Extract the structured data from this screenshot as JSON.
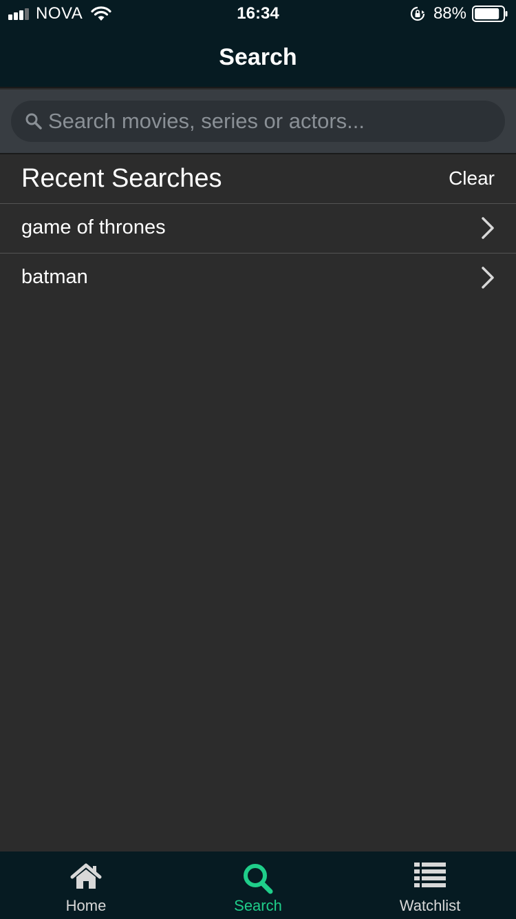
{
  "status_bar": {
    "carrier": "NOVA",
    "time": "16:34",
    "battery_percent": "88%",
    "battery_level": 0.88,
    "icons": [
      "signal-icon",
      "wifi-icon",
      "rotation-lock-icon",
      "battery-icon"
    ]
  },
  "nav": {
    "title": "Search"
  },
  "search": {
    "placeholder": "Search movies, series or actors...",
    "value": ""
  },
  "recent": {
    "title": "Recent Searches",
    "clear_label": "Clear",
    "items": [
      {
        "label": "game of thrones"
      },
      {
        "label": "batman"
      }
    ]
  },
  "tabs": [
    {
      "label": "Home",
      "icon": "home-icon",
      "active": false
    },
    {
      "label": "Search",
      "icon": "search-icon",
      "active": true
    },
    {
      "label": "Watchlist",
      "icon": "list-icon",
      "active": false
    }
  ],
  "colors": {
    "accent": "#1fce8a",
    "bar_background": "#061b22",
    "content_background": "#2c2c2c",
    "inactive_tab": "#d8d8d8"
  }
}
